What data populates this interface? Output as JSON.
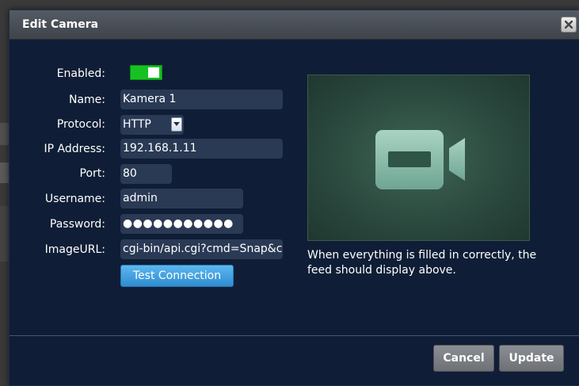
{
  "dialog": {
    "title": "Edit Camera",
    "close_icon": "close-icon"
  },
  "form": {
    "enabled": {
      "label": "Enabled:",
      "value": true
    },
    "name": {
      "label": "Name:",
      "value": "Kamera 1"
    },
    "protocol": {
      "label": "Protocol:",
      "value": "HTTP"
    },
    "ip_address": {
      "label": "IP Address:",
      "value": "192.168.1.11"
    },
    "port": {
      "label": "Port:",
      "value": "80"
    },
    "username": {
      "label": "Username:",
      "value": "admin"
    },
    "password": {
      "label": "Password:",
      "value": "●●●●●●●●●●●"
    },
    "image_url": {
      "label": "ImageURL:",
      "value": "cgi-bin/api.cgi?cmd=Snap&ch"
    },
    "test_button": "Test Connection"
  },
  "preview": {
    "icon": "video-camera-icon",
    "help_text": "When everything is filled in correctly, the feed should display above."
  },
  "footer": {
    "cancel_label": "Cancel",
    "update_label": "Update"
  },
  "colors": {
    "dialog_bg": "#0f1e36",
    "toggle_on": "#16c221",
    "accent_button": "#3a9ad9"
  }
}
